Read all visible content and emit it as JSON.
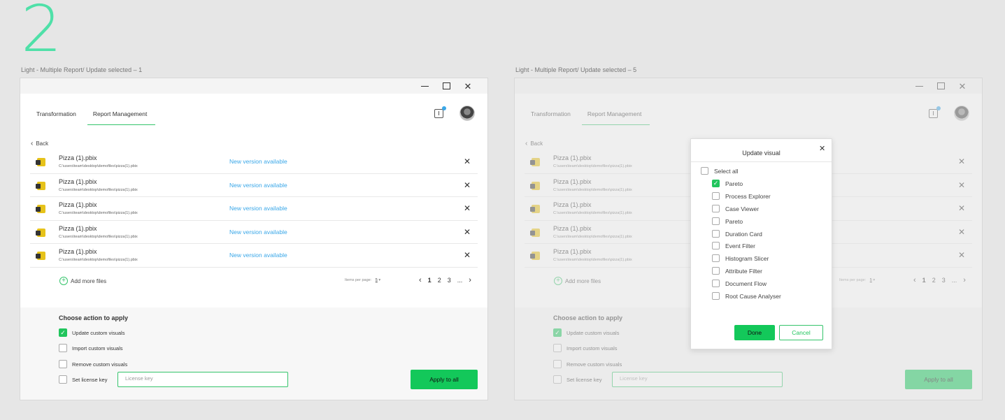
{
  "page_number": "2",
  "frames": [
    {
      "caption": "Light - Multiple Report/ Update selected – 1",
      "tabs": [
        "Transformation",
        "Report Management"
      ],
      "active_tab": "Report Management",
      "back_label": "Back",
      "files": [
        {
          "name": "Pizza (1).pbix",
          "path": "C:\\users\\team\\desktop\\demofiles\\pizza(1).pbix",
          "status": "New version available"
        },
        {
          "name": "Pizza (1).pbix",
          "path": "C:\\users\\team\\desktop\\demofiles\\pizza(1).pbix",
          "status": "New version available"
        },
        {
          "name": "Pizza (1).pbix",
          "path": "C:\\users\\team\\desktop\\demofiles\\pizza(1).pbix",
          "status": "New version available"
        },
        {
          "name": "Pizza (1).pbix",
          "path": "C:\\users\\team\\desktop\\demofiles\\pizza(1).pbix",
          "status": "New version available"
        },
        {
          "name": "Pizza (1).pbix",
          "path": "C:\\users\\team\\desktop\\demofiles\\pizza(1).pbix",
          "status": "New version available"
        }
      ],
      "add_more_label": "Add more files",
      "items_per_page_label": "Items per page:",
      "items_per_page_value": "5",
      "pages": [
        "1",
        "2",
        "3",
        "..."
      ],
      "current_page": "1",
      "actions_title": "Choose action to apply",
      "actions": [
        {
          "label": "Update custom visuals",
          "checked": true
        },
        {
          "label": "Import custom visuals",
          "checked": false
        },
        {
          "label": "Remove custom visuals",
          "checked": false
        },
        {
          "label": "Set license key",
          "checked": false
        }
      ],
      "license_placeholder": "License key",
      "apply_label": "Apply to all"
    },
    {
      "caption": "Light - Multiple Report/ Update selected – 5"
    }
  ],
  "modal": {
    "title": "Update visual",
    "select_all": "Select all",
    "items": [
      {
        "label": "Pareto",
        "checked": true
      },
      {
        "label": "Process Explorer",
        "checked": false
      },
      {
        "label": "Case Viewer",
        "checked": false
      },
      {
        "label": "Pareto",
        "checked": false
      },
      {
        "label": "Duration Card",
        "checked": false
      },
      {
        "label": "Event Filter",
        "checked": false
      },
      {
        "label": "Histogram Slicer",
        "checked": false
      },
      {
        "label": "Attribute Filter",
        "checked": false
      },
      {
        "label": "Document Flow",
        "checked": false
      },
      {
        "label": "Root Cause Analyser",
        "checked": false
      }
    ],
    "done_label": "Done",
    "cancel_label": "Cancel"
  },
  "colors": {
    "accent_green": "#13c85a",
    "link_blue": "#3aa7e8",
    "number_mint": "#4fe0a8"
  },
  "icons": [
    "minimize-icon",
    "maximize-icon",
    "close-icon",
    "update-icon",
    "avatar",
    "chevron-left-icon",
    "file-icon",
    "plus-icon",
    "chevron-right-icon",
    "check-icon"
  ]
}
